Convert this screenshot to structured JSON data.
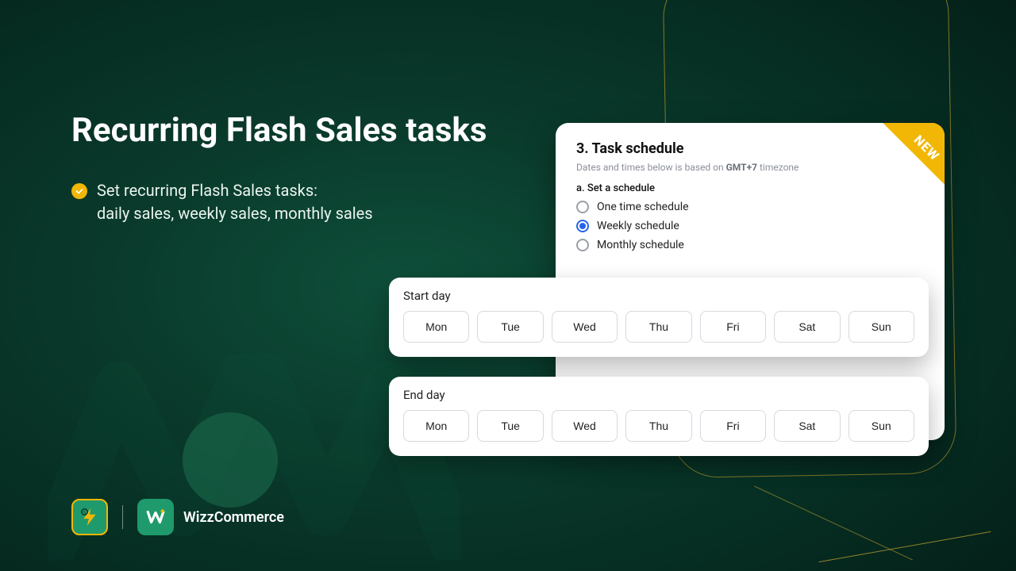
{
  "colors": {
    "accent": "#f2b705",
    "brand": "#1f9a6c",
    "radio_selected": "#2563eb"
  },
  "headline": "Recurring Flash Sales tasks",
  "bullet": {
    "line1": "Set recurring Flash Sales tasks:",
    "line2": "daily sales, weekly sales, monthly sales"
  },
  "card": {
    "title": "3. Task schedule",
    "tz_prefix": "Dates and times below is based on ",
    "tz_value": "GMT+7",
    "tz_suffix": " timezone",
    "subheading": "a. Set a schedule",
    "options": [
      {
        "label": "One time schedule",
        "selected": false
      },
      {
        "label": "Weekly schedule",
        "selected": true
      },
      {
        "label": "Monthly schedule",
        "selected": false
      }
    ],
    "end_day_hint": "End day",
    "ribbon": "NEW"
  },
  "start_panel": {
    "label": "Start day",
    "days": [
      "Mon",
      "Tue",
      "Wed",
      "Thu",
      "Fri",
      "Sat",
      "Sun"
    ]
  },
  "end_panel": {
    "label": "End day",
    "days": [
      "Mon",
      "Tue",
      "Wed",
      "Thu",
      "Fri",
      "Sat",
      "Sun"
    ]
  },
  "footer": {
    "brand": "WizzCommerce",
    "left_icon": "flash-sale-icon",
    "right_icon": "wizz-logo-icon"
  }
}
